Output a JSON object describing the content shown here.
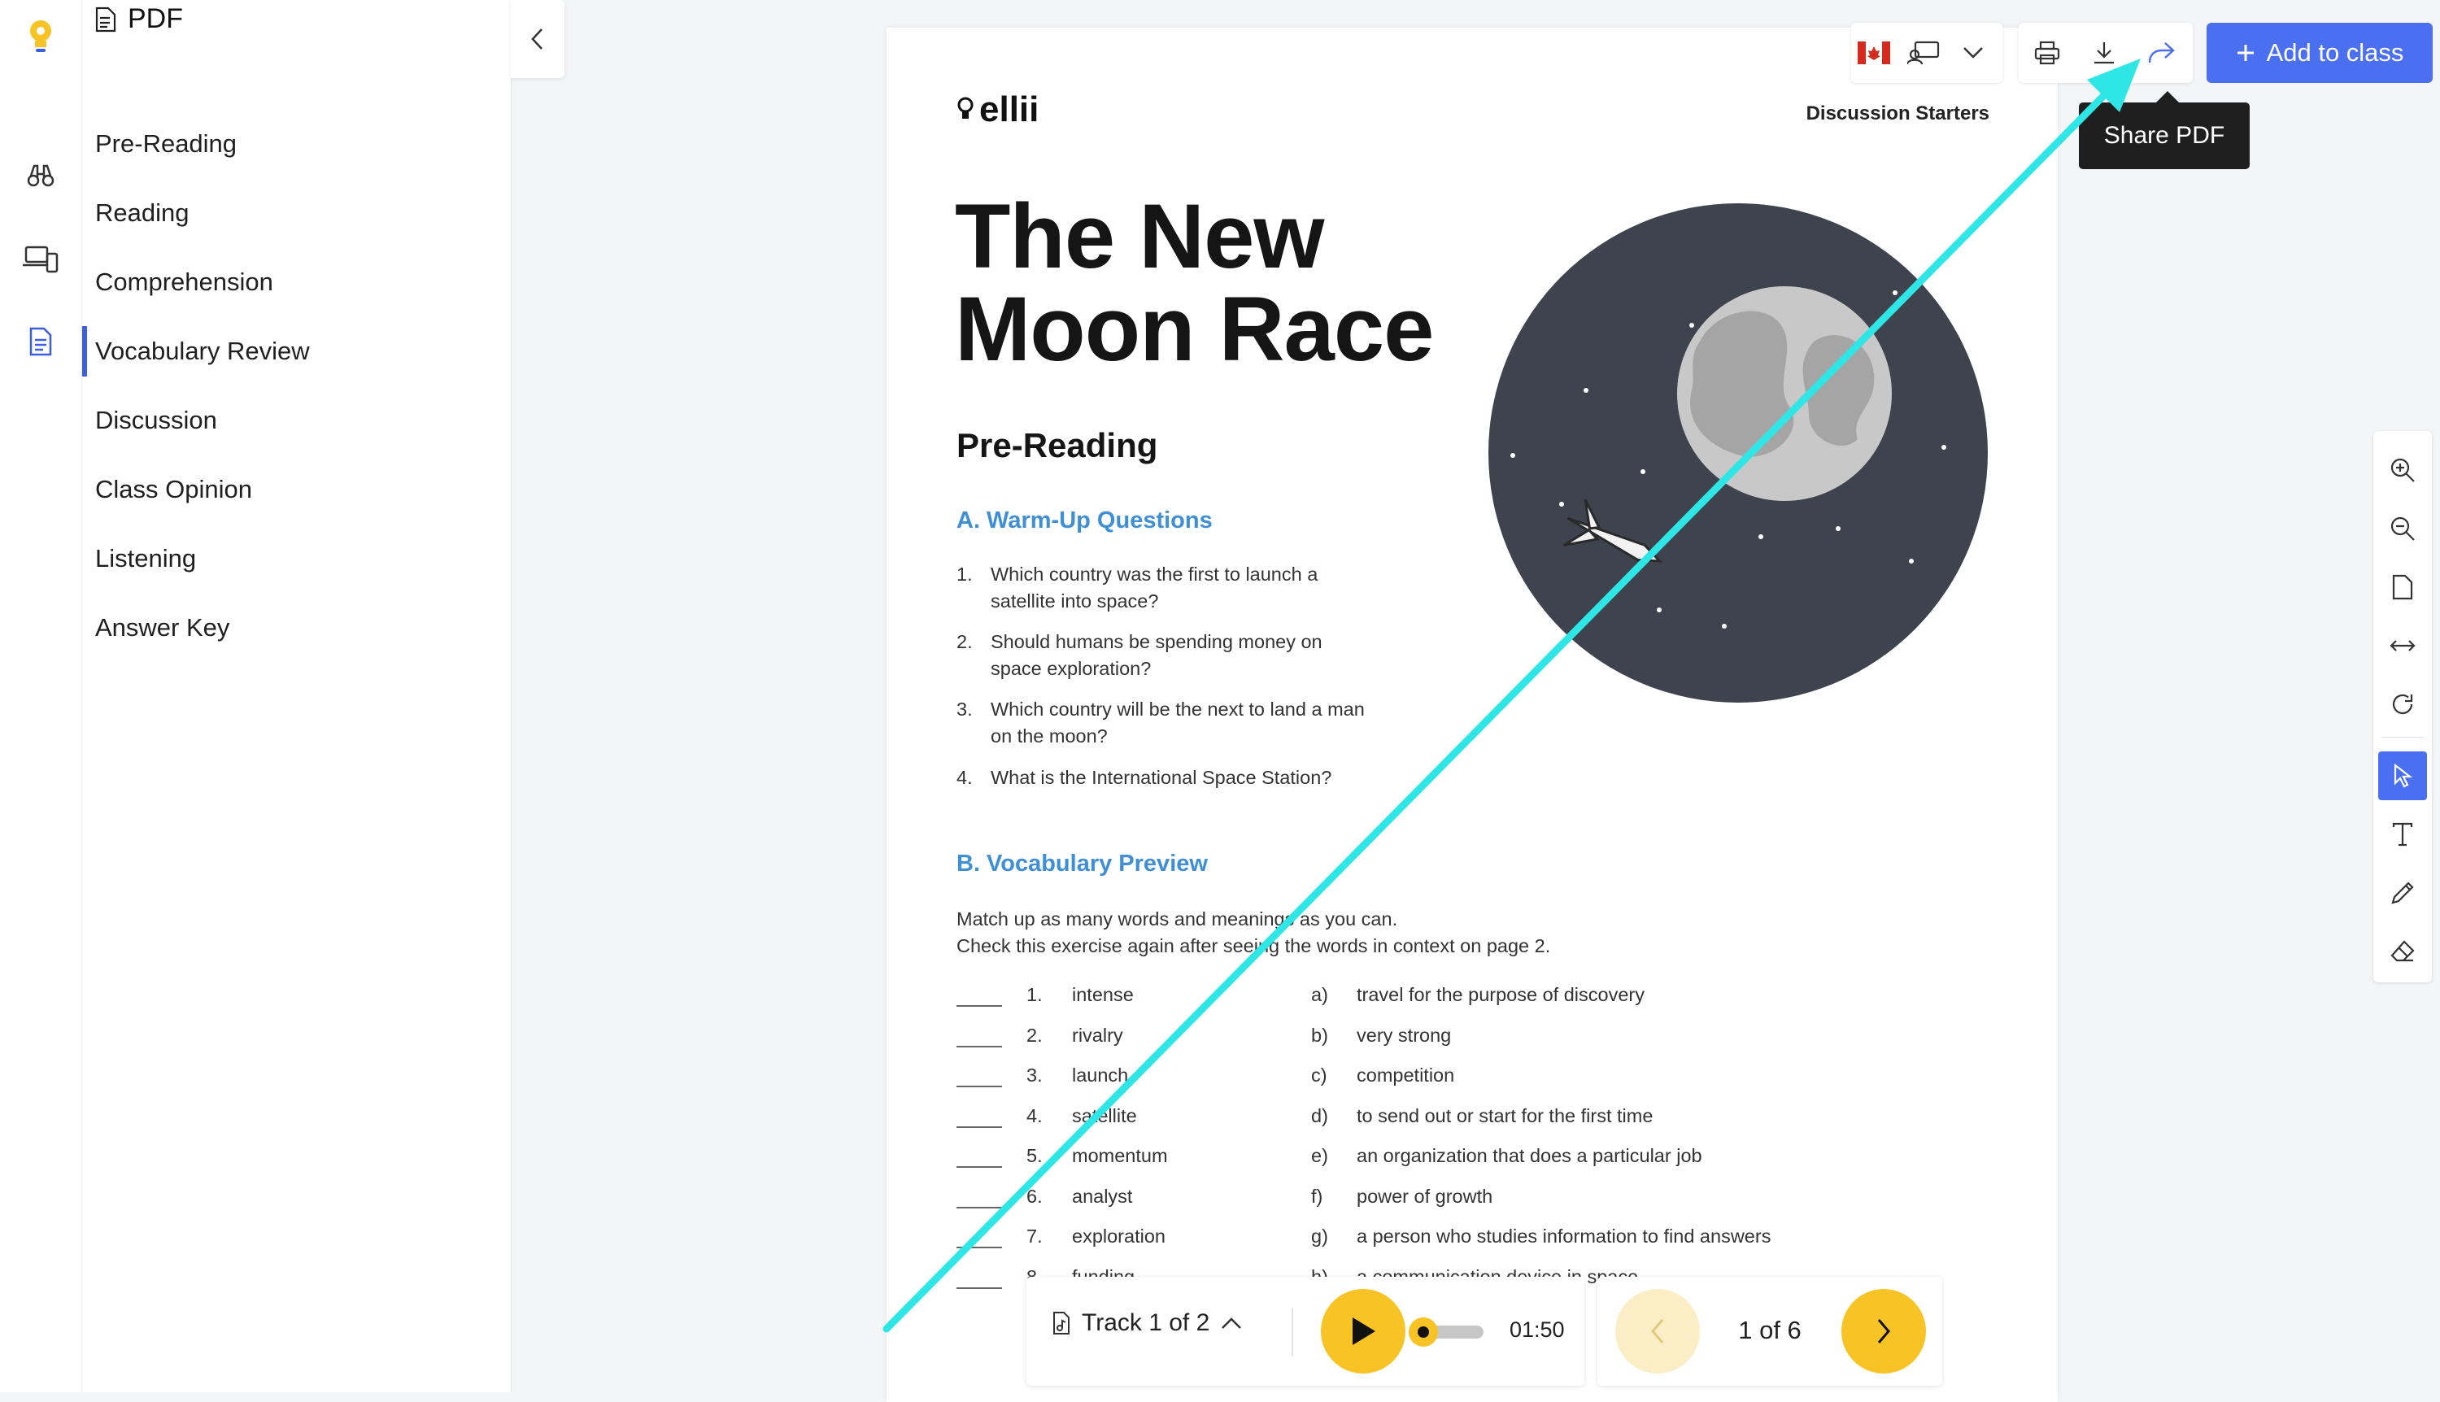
{
  "sidebar": {
    "title": "PDF",
    "items": [
      {
        "label": "Pre-Reading"
      },
      {
        "label": "Reading"
      },
      {
        "label": "Comprehension"
      },
      {
        "label": "Vocabulary Review",
        "active": true
      },
      {
        "label": "Discussion"
      },
      {
        "label": "Class Opinion"
      },
      {
        "label": "Listening"
      },
      {
        "label": "Answer Key"
      }
    ]
  },
  "toolbar": {
    "add_label": "Add to class",
    "tooltip": "Share PDF"
  },
  "document": {
    "logo": "ellii",
    "category": "Discussion Starters",
    "title_line1": "The New",
    "title_line2": "Moon Race",
    "section": "Pre-Reading",
    "warmup_heading": "A. Warm-Up Questions",
    "questions": [
      {
        "n": "1.",
        "text": "Which country was the first to launch a satellite into space?"
      },
      {
        "n": "2.",
        "text": "Should humans be spending money on space exploration?"
      },
      {
        "n": "3.",
        "text": "Which country will be the next to land a man on the moon?"
      },
      {
        "n": "4.",
        "text": "What is the International Space Station?"
      }
    ],
    "vocab_heading": "B. Vocabulary Preview",
    "instructions_1": "Match up as many words and meanings as you can.",
    "instructions_2": "Check this exercise again after seeing the words in context on page 2.",
    "vocab": [
      {
        "n": "1.",
        "word": "intense",
        "letter": "a)",
        "meaning": "travel for the purpose of discovery"
      },
      {
        "n": "2.",
        "word": "rivalry",
        "letter": "b)",
        "meaning": "very strong"
      },
      {
        "n": "3.",
        "word": "launch",
        "letter": "c)",
        "meaning": "competition"
      },
      {
        "n": "4.",
        "word": "satellite",
        "letter": "d)",
        "meaning": "to send out or start for the first time"
      },
      {
        "n": "5.",
        "word": "momentum",
        "letter": "e)",
        "meaning": "an organization that does a particular job"
      },
      {
        "n": "6.",
        "word": "analyst",
        "letter": "f)",
        "meaning": "power of growth"
      },
      {
        "n": "7.",
        "word": "exploration",
        "letter": "g)",
        "meaning": "a person who studies information to find answers"
      },
      {
        "n": "8.",
        "word": "funding",
        "letter": "h)",
        "meaning": "a communication device in space"
      }
    ]
  },
  "audio": {
    "track_label": "Track 1 of 2",
    "time": "01:50",
    "progress": 0.08
  },
  "pager": {
    "label": "1 of 6"
  },
  "colors": {
    "accent": "#4a6ff0",
    "play": "#f7c325",
    "arrow": "#2fe6e6",
    "heading_blue": "#3f8fd6"
  }
}
